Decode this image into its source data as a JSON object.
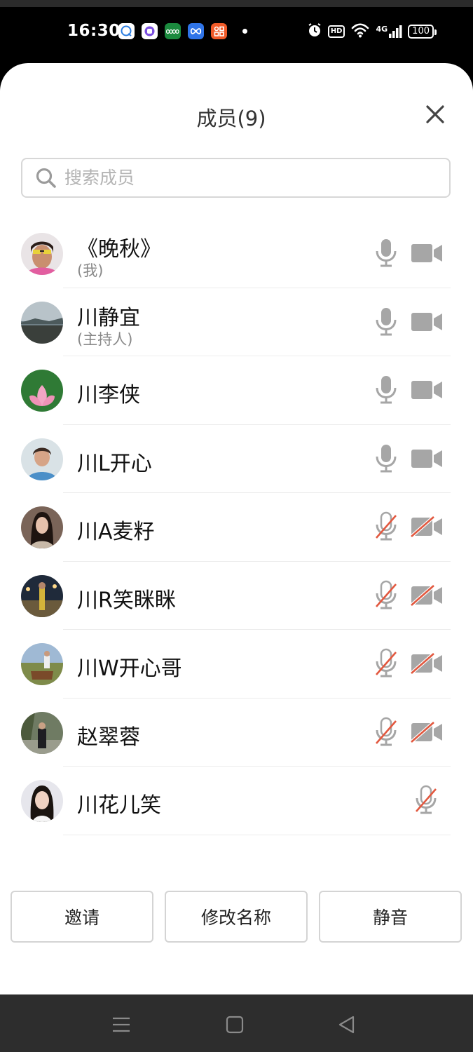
{
  "status_bar": {
    "time": "16:30",
    "network": "4G",
    "battery": "100",
    "hd": "HD",
    "app_icons": [
      "message-bubble-icon",
      "purple-app-icon",
      "oppo-app-icon",
      "cloud-infinity-icon",
      "orange-app-icon"
    ]
  },
  "sheet": {
    "title": "成员(9)",
    "close_icon": "close-icon"
  },
  "search": {
    "placeholder": "搜索成员"
  },
  "members": [
    {
      "name": "《晚秋》",
      "sub": "(我)",
      "mic": "on",
      "camera": "on"
    },
    {
      "name": "川静宜",
      "sub": "(主持人)",
      "mic": "on",
      "camera": "on"
    },
    {
      "name": "川李侠",
      "sub": "",
      "mic": "on",
      "camera": "on"
    },
    {
      "name": "川L开心",
      "sub": "",
      "mic": "on",
      "camera": "on"
    },
    {
      "name": "川A麦籽",
      "sub": "",
      "mic": "off",
      "camera": "off"
    },
    {
      "name": "川R笑眯眯",
      "sub": "",
      "mic": "off",
      "camera": "off"
    },
    {
      "name": "川W开心哥",
      "sub": "",
      "mic": "off",
      "camera": "off"
    },
    {
      "name": "赵翠蓉",
      "sub": "",
      "mic": "off",
      "camera": "off"
    },
    {
      "name": "川花儿笑",
      "sub": "",
      "mic": "off",
      "camera": "none"
    }
  ],
  "actions": {
    "invite": "邀请",
    "rename": "修改名称",
    "mute": "静音"
  },
  "colors": {
    "icon_gray": "#a6a6a6",
    "strike_red": "#e2583f",
    "sheet_bg": "#ffffff",
    "nav_bg": "#2d2d2d"
  }
}
